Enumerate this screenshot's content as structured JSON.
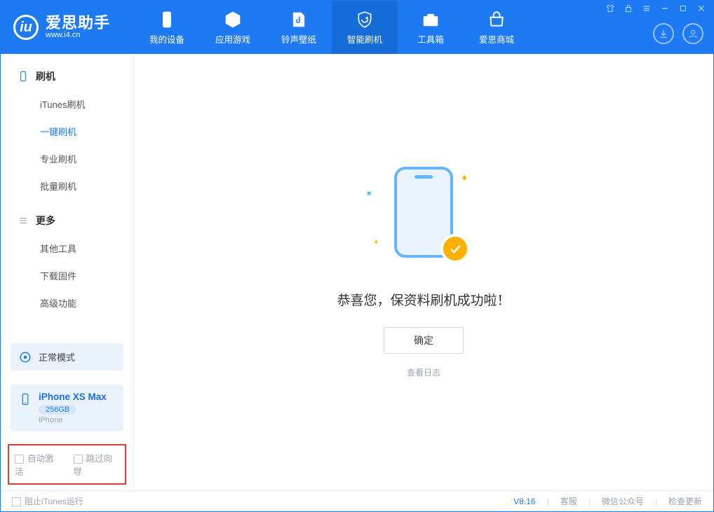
{
  "app": {
    "name": "爱思助手",
    "url": "www.i4.cn"
  },
  "nav": {
    "items": [
      {
        "label": "我的设备"
      },
      {
        "label": "应用游戏"
      },
      {
        "label": "铃声壁纸"
      },
      {
        "label": "智能刷机"
      },
      {
        "label": "工具箱"
      },
      {
        "label": "爱思商城"
      }
    ],
    "active_index": 3
  },
  "sidebar": {
    "section1_title": "刷机",
    "section1_items": [
      "iTunes刷机",
      "一键刷机",
      "专业刷机",
      "批量刷机"
    ],
    "section1_active_index": 1,
    "section2_title": "更多",
    "section2_items": [
      "其他工具",
      "下载固件",
      "高级功能"
    ]
  },
  "mode_card": {
    "label": "正常模式"
  },
  "device_card": {
    "name": "iPhone XS Max",
    "storage": "256GB",
    "type": "iPhone"
  },
  "bottom_options": {
    "auto_activate": "自动激活",
    "skip_guide": "跳过向导"
  },
  "main": {
    "success_text": "恭喜您，保资料刷机成功啦！",
    "ok_button": "确定",
    "view_log": "查看日志"
  },
  "statusbar": {
    "block_itunes": "阻止iTunes运行",
    "version": "V8.16",
    "support": "客服",
    "wechat": "微信公众号",
    "check_update": "检查更新"
  }
}
